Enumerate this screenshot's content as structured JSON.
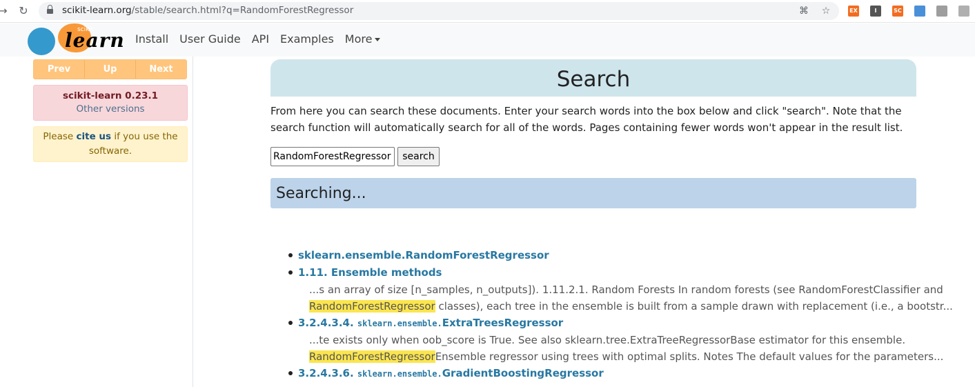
{
  "browser": {
    "url_domain": "scikit-learn.org",
    "url_path": "/stable/search.html?q=RandomForestRegressor",
    "extensions": [
      {
        "name": "ex-extension-icon",
        "text": "EX",
        "color": "#f26d21"
      },
      {
        "name": "i-extension-icon",
        "text": "I",
        "color": "#555555"
      },
      {
        "name": "sc-extension-icon",
        "text": "SC",
        "color": "#f26d21"
      },
      {
        "name": "blue-extension-icon",
        "text": "",
        "color": "#4a90d9"
      },
      {
        "name": "gray-extension-icon",
        "text": "",
        "color": "#9e9e9e"
      },
      {
        "name": "window-extension-icon",
        "text": "",
        "color": "#b0b0b0"
      }
    ]
  },
  "navbar": {
    "logo_small": "scikit",
    "logo_big": "learn",
    "links": [
      "Install",
      "User Guide",
      "API",
      "Examples"
    ],
    "more_label": "More"
  },
  "sidebar": {
    "rel_buttons": [
      "Prev",
      "Up",
      "Next"
    ],
    "version_title": "scikit-learn 0.23.1",
    "version_link": "Other versions",
    "cite_prefix": "Please ",
    "cite_link": "cite us",
    "cite_suffix": " if you use the software."
  },
  "main": {
    "title": "Search",
    "intro": "From here you can search these documents. Enter your search words into the box below and click \"search\". Note that the search function will automatically search for all of the words. Pages containing fewer words won't appear in the result list.",
    "search_value": "RandomForestRegressor",
    "search_button": "search",
    "searching_heading": "Searching..."
  },
  "results": [
    {
      "prefix": "",
      "code": "",
      "name": "sklearn.ensemble.RandomForestRegressor",
      "snippet_lines": []
    },
    {
      "prefix": "",
      "code": "",
      "name": "1.11. Ensemble methods",
      "snippet_lines": [
        {
          "pre": "",
          "hl": "",
          "post": "...s an array of size [n_samples, n_outputs]). 1.11.2.1. Random Forests In random forests (see RandomForestClassifier and"
        },
        {
          "pre": "",
          "hl": "RandomForestRegressor",
          "post": " classes), each tree in the ensemble is built from a sample drawn with replacement (i.e., a bootstr..."
        }
      ]
    },
    {
      "prefix": "3.2.4.3.4. ",
      "code": "sklearn.ensemble.",
      "name": "ExtraTreesRegressor",
      "snippet_lines": [
        {
          "pre": "",
          "hl": "",
          "post": "...te exists only when oob_score is True. See also sklearn.tree.ExtraTreeRegressorBase estimator for this ensemble."
        },
        {
          "pre": "",
          "hl": "RandomForestRegressor",
          "post": "Ensemble regressor using trees with optimal splits. Notes The default values for the parameters..."
        }
      ]
    },
    {
      "prefix": "3.2.4.3.6. ",
      "code": "sklearn.ensemble.",
      "name": "GradientBoostingRegressor",
      "snippet_lines": []
    }
  ]
}
